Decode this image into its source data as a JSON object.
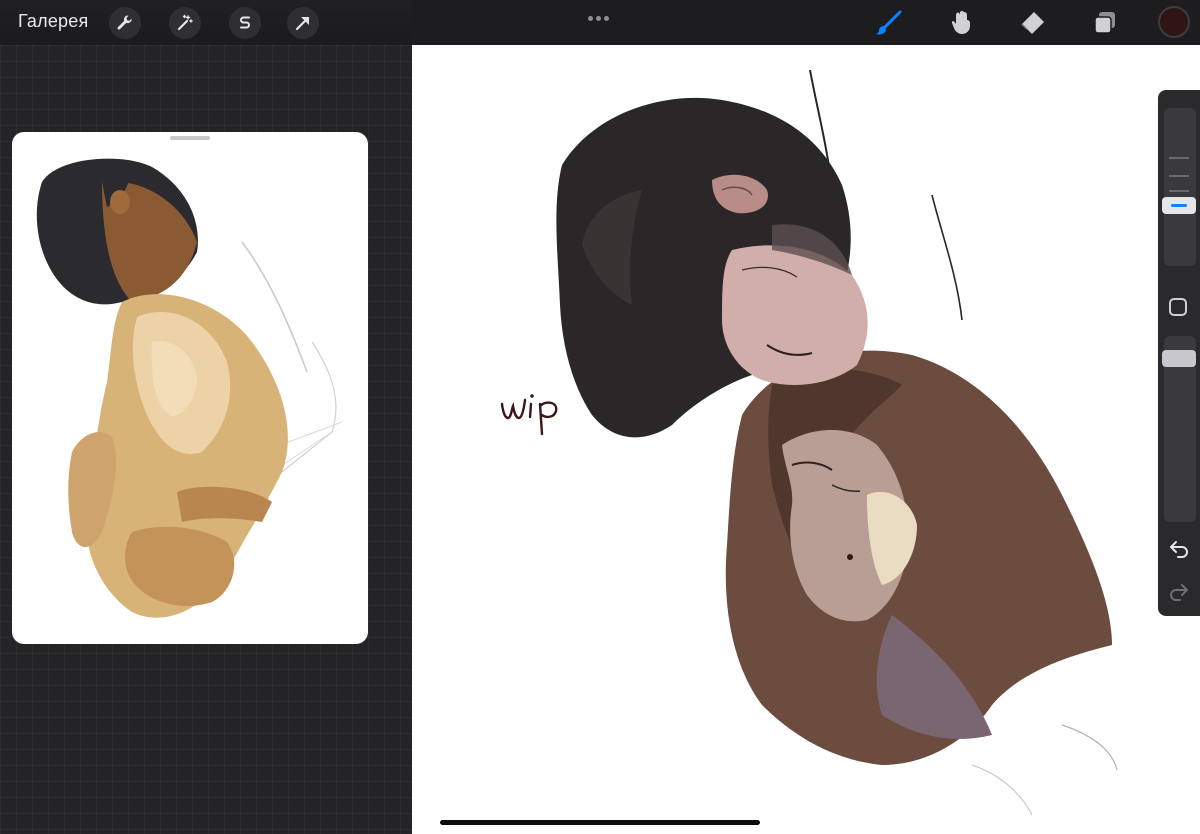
{
  "topbar": {
    "gallery_label": "Галерея",
    "left_tools": [
      {
        "name": "wrench-icon"
      },
      {
        "name": "magic-wand-icon"
      },
      {
        "name": "selection-s-icon"
      },
      {
        "name": "transform-arrow-icon"
      }
    ],
    "right_tools": [
      {
        "name": "brush-icon",
        "active": true
      },
      {
        "name": "smudge-icon",
        "active": false
      },
      {
        "name": "eraser-icon",
        "active": false
      },
      {
        "name": "layers-icon",
        "active": false
      }
    ],
    "active_color": "#2f1614",
    "accent_color": "#0a84ff"
  },
  "canvas": {
    "handwritten_note": "wip"
  },
  "sidebar": {
    "brush_size_fraction": 0.45,
    "opacity_fraction": 0.05
  }
}
